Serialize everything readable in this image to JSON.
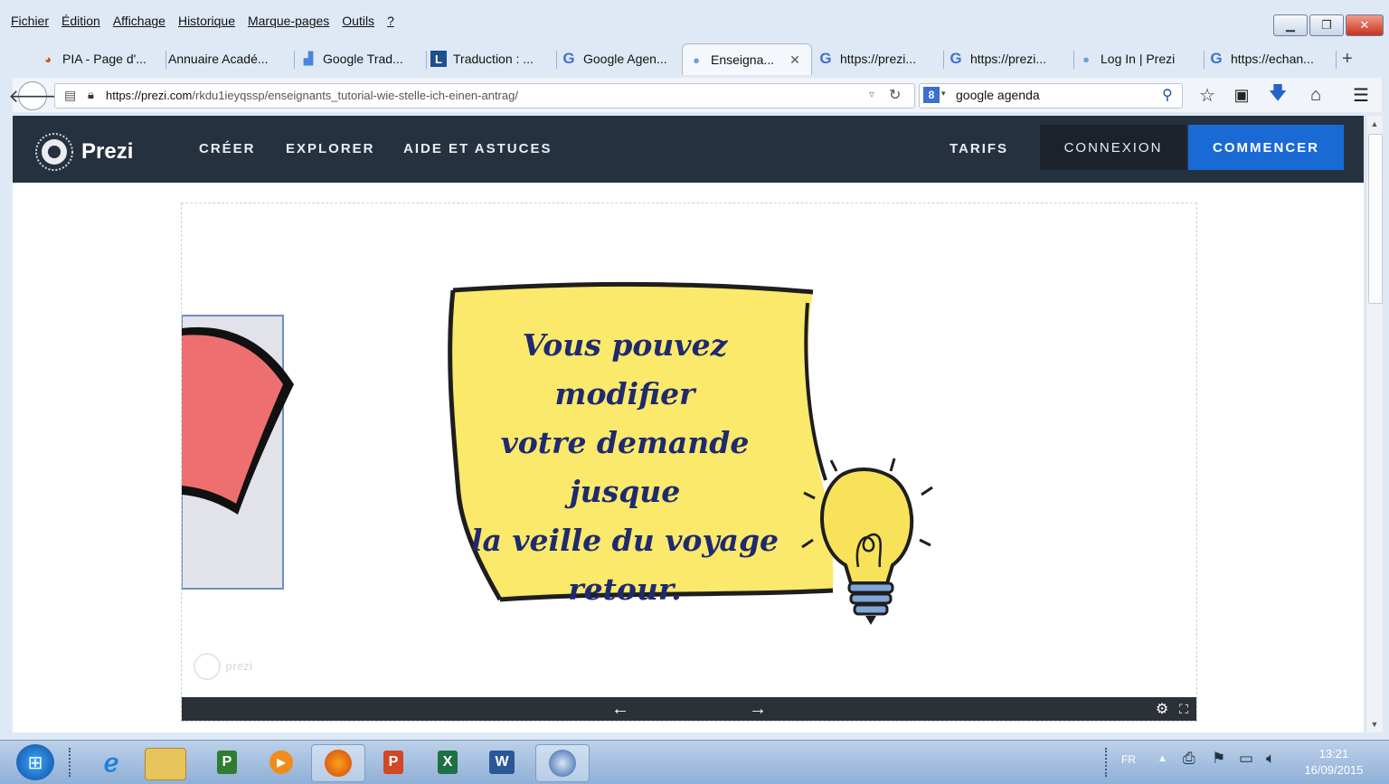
{
  "menu": [
    "Fichier",
    "Édition",
    "Affichage",
    "Historique",
    "Marque-pages",
    "Outils",
    "?"
  ],
  "tabs": [
    {
      "label": "PIA - Page d'...",
      "icon": "firefox-icon"
    },
    {
      "label": "Annuaire Acadé...",
      "icon": "none"
    },
    {
      "label": "Google Trad...",
      "icon": "translate-icon"
    },
    {
      "label": "Traduction : ...",
      "icon": "l-icon"
    },
    {
      "label": "Google Agen...",
      "icon": "google-icon"
    },
    {
      "label": "Enseigna...",
      "icon": "globe-icon",
      "active": true
    },
    {
      "label": "https://prezi...",
      "icon": "google-icon"
    },
    {
      "label": "https://prezi...",
      "icon": "google-icon"
    },
    {
      "label": "Log In | Prezi",
      "icon": "globe-icon"
    },
    {
      "label": "https://echan...",
      "icon": "google-icon"
    }
  ],
  "new_tab": "+",
  "address": {
    "domain": "https://prezi.com",
    "path": "/rkdu1ieyqssp/enseignants_tutorial-wie-stelle-ich-einen-antrag/"
  },
  "search": {
    "value": "google agenda"
  },
  "site": {
    "logo_text": "Prezi",
    "nav": [
      "CRÉER",
      "EXPLORER",
      "AIDE ET ASTUCES"
    ],
    "tarifs": "TARIFS",
    "connexion": "CONNEXION",
    "commencer": "COMMENCER"
  },
  "slide": {
    "lines": [
      "Vous pouvez modifier",
      "votre demande jusque",
      "la veille du voyage",
      "retour."
    ],
    "watermark": "prezi"
  },
  "taskbar": {
    "lang": "FR",
    "time": "13:21",
    "date": "16/09/2015",
    "apps": [
      "ie-icon",
      "explorer-icon",
      "project-icon",
      "media-player-icon",
      "firefox-icon",
      "powerpoint-icon",
      "excel-icon",
      "word-icon",
      "thunderbird-icon"
    ]
  }
}
